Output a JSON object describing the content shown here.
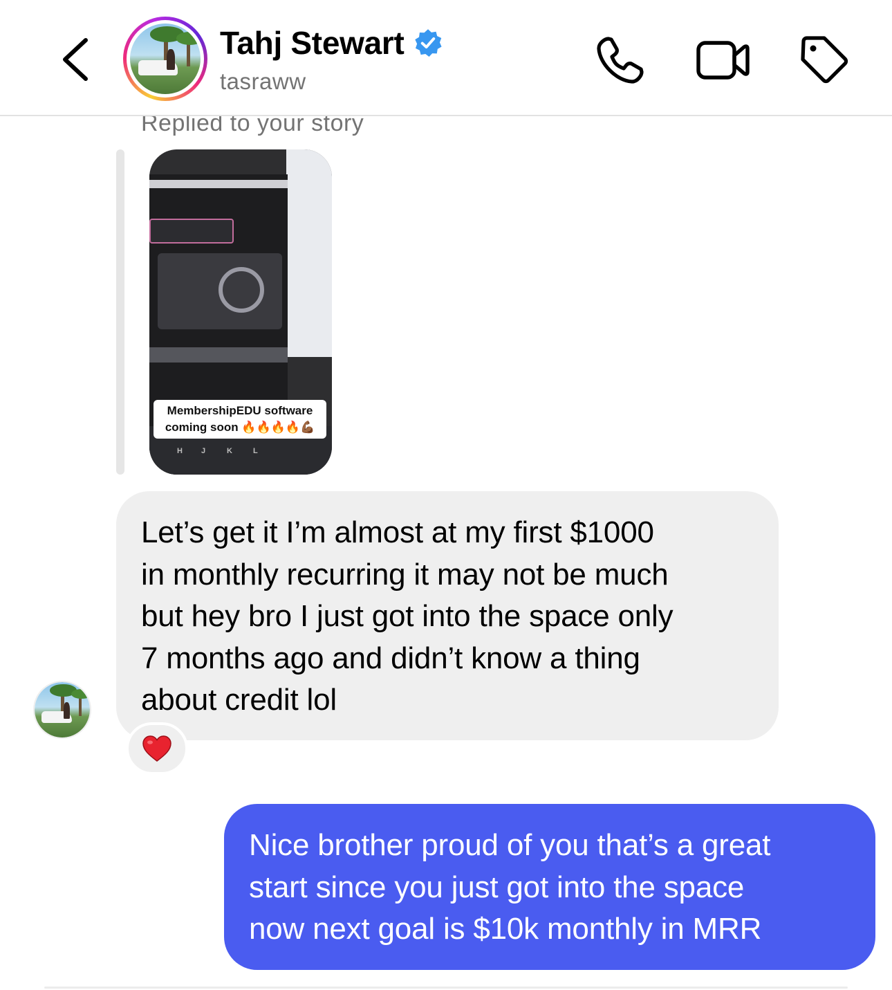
{
  "header": {
    "back_icon": "chevron-left-icon",
    "contact_name": "Tahj Stewart",
    "verified_icon": "verified-badge-icon",
    "username": "tasraww",
    "actions": [
      {
        "name": "phone-call",
        "icon": "phone-icon"
      },
      {
        "name": "video-call",
        "icon": "video-camera-icon"
      },
      {
        "name": "label",
        "icon": "tag-icon"
      }
    ],
    "story_ring_colors": [
      "#f9ce34",
      "#ee2a7b",
      "#6228d7"
    ]
  },
  "story_reply": {
    "label": "Replied to your story",
    "caption_line1": "MembershipEDU software",
    "caption_line2": "coming soon 🔥🔥🔥🔥💪🏾"
  },
  "messages": [
    {
      "direction": "incoming",
      "lines": [
        "Let’s get it I’m almost at my first $1000",
        "in monthly recurring it may not be much",
        "but hey bro I just got into the space only",
        "7 months ago and didn’t know a thing",
        "about credit lol"
      ],
      "reaction": "❤️"
    },
    {
      "direction": "outgoing",
      "lines": [
        "Nice brother proud of you that’s a great",
        "start since you just got into the space",
        "now next goal is $10k monthly in MRR"
      ]
    }
  ],
  "colors": {
    "outgoing_bubble": "#4a5cf0",
    "incoming_bubble": "#efefef",
    "verified": "#3897f0",
    "secondary_text": "#737373"
  }
}
